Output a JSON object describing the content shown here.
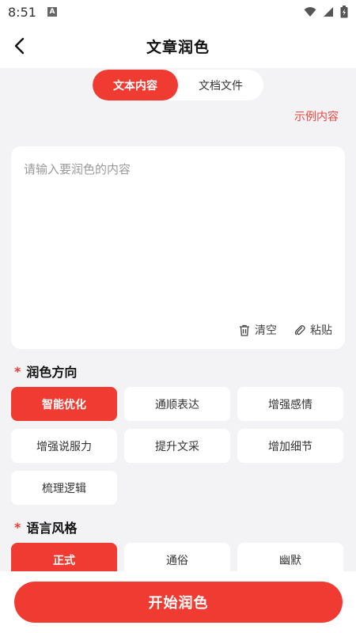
{
  "status": {
    "time": "8:51",
    "notification_glyph": "A"
  },
  "header": {
    "title": "文章润色"
  },
  "tabs": [
    {
      "label": "文本内容",
      "active": true
    },
    {
      "label": "文档文件",
      "active": false
    }
  ],
  "example_link": "示例内容",
  "input": {
    "placeholder": "请输入要润色的内容",
    "value": ""
  },
  "actions": {
    "clear": "清空",
    "paste": "粘贴"
  },
  "direction": {
    "required_mark": "*",
    "title": "润色方向",
    "options": [
      {
        "label": "智能优化",
        "selected": true
      },
      {
        "label": "通顺表达",
        "selected": false
      },
      {
        "label": "增强感情",
        "selected": false
      },
      {
        "label": "增强说服力",
        "selected": false
      },
      {
        "label": "提升文采",
        "selected": false
      },
      {
        "label": "增加细节",
        "selected": false
      },
      {
        "label": "梳理逻辑",
        "selected": false
      }
    ]
  },
  "style": {
    "required_mark": "*",
    "title": "语言风格",
    "options": [
      {
        "label": "正式",
        "selected": true
      },
      {
        "label": "通俗",
        "selected": false
      },
      {
        "label": "幽默",
        "selected": false
      }
    ]
  },
  "start_button": "开始润色",
  "colors": {
    "accent": "#ef3b32",
    "background": "#f3f3f5",
    "card": "#ffffff"
  }
}
